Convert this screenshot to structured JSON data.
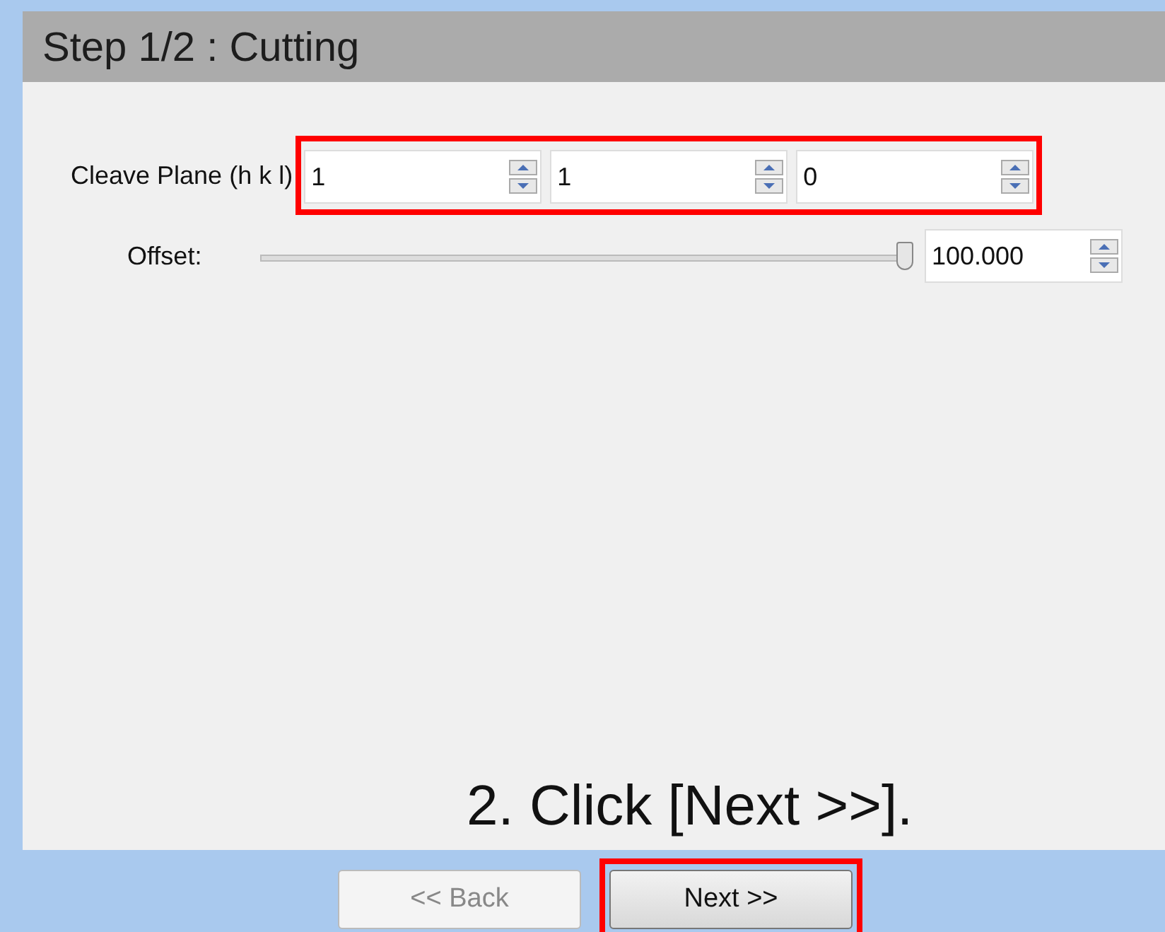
{
  "header": {
    "title": "Step 1/2 : Cutting"
  },
  "cleave_plane": {
    "label": "Cleave Plane (h k l)",
    "highlighted": true,
    "values": [
      "1",
      "1",
      "0"
    ]
  },
  "offset": {
    "label": "Offset:",
    "level": 1.0,
    "value": "100.000"
  },
  "instruction": "2. Click [Next >>].",
  "buttons": [
    {
      "label": "<< Back",
      "disabled": true,
      "highlighted": false
    },
    {
      "label": "Next >>",
      "disabled": false,
      "highlighted": true
    }
  ]
}
